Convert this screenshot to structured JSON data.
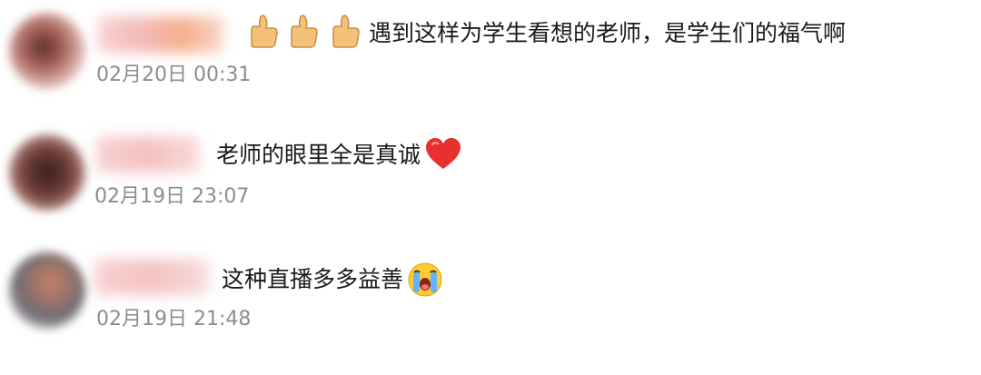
{
  "comments": [
    {
      "text": "遇到这样为学生看想的老师，是学生们的福气啊",
      "emojis": [
        "thumbs-up-icon",
        "thumbs-up-icon",
        "thumbs-up-icon"
      ],
      "time": "02月20日 00:31"
    },
    {
      "text": "老师的眼里全是真诚",
      "emojis": [
        "red-heart-icon"
      ],
      "time": "02月19日 23:07"
    },
    {
      "text": "这种直播多多益善",
      "emojis": [
        "loudly-crying-face-icon"
      ],
      "time": "02月19日 21:48"
    }
  ],
  "colors": {
    "text": "#1a1a1a",
    "time": "#8c8c8c",
    "heart": "#e8312f",
    "thumb": "#f2c27a",
    "face": "#ffcc33"
  }
}
